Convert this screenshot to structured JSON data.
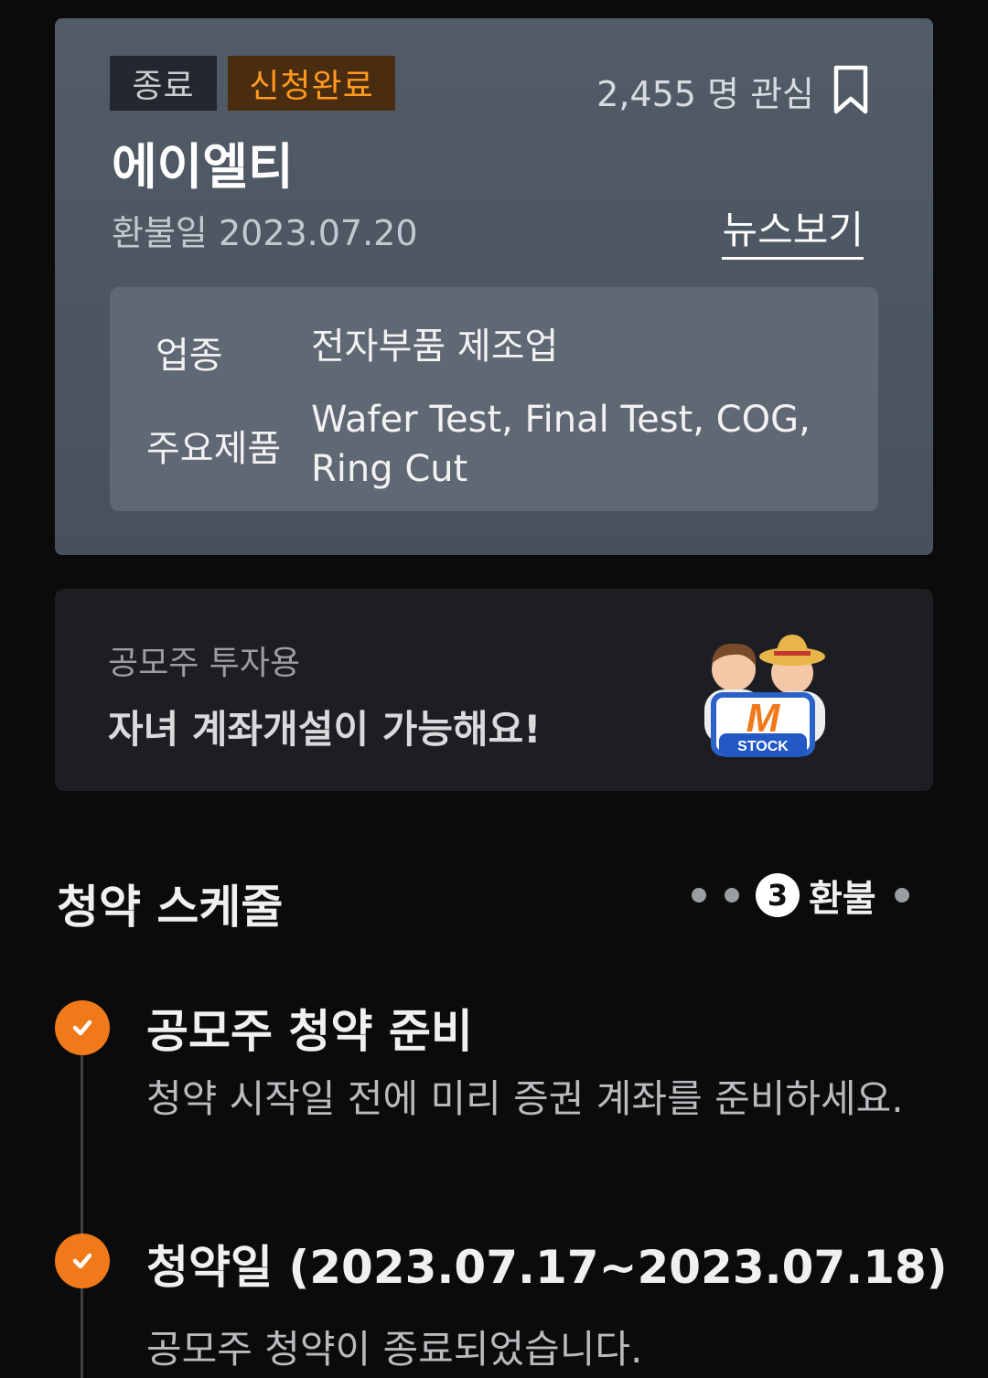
{
  "ipo": {
    "status_badge": "종료",
    "application_badge": "신청완료",
    "interest_text": "2,455 명 관심",
    "company_name": "에이엘티",
    "refund_date": "환불일 2023.07.20",
    "news_link": "뉴스보기",
    "industry_label": "업종",
    "industry_value": "전자부품 제조업",
    "products_label": "주요제품",
    "products_value": "Wafer Test, Final Test, COG, Ring Cut",
    "bookmark_icon": "bookmark-outline-icon"
  },
  "promo": {
    "subtitle": "공모주 투자용",
    "headline": "자녀 계좌개설이 가능해요!",
    "art_letter": "M",
    "art_caption": "STOCK",
    "art_icon": "kids-with-stock-sign-illustration"
  },
  "schedule": {
    "title": "청약 스케줄",
    "current_step_number": "3",
    "current_step_label": "환불",
    "items": [
      {
        "title": "공모주 청약 준비",
        "description": "청약 시작일 전에 미리 증권 계좌를 준비하세요.",
        "icon": "check-icon"
      },
      {
        "title": "청약일 (2023.07.17~2023.07.18)",
        "description": "공모주 청약이 종료되었습니다.",
        "icon": "check-icon"
      }
    ]
  },
  "colors": {
    "accent_orange": "#f07a1a",
    "applied_badge_text": "#ff9a1f",
    "card_background": "#525c67"
  }
}
